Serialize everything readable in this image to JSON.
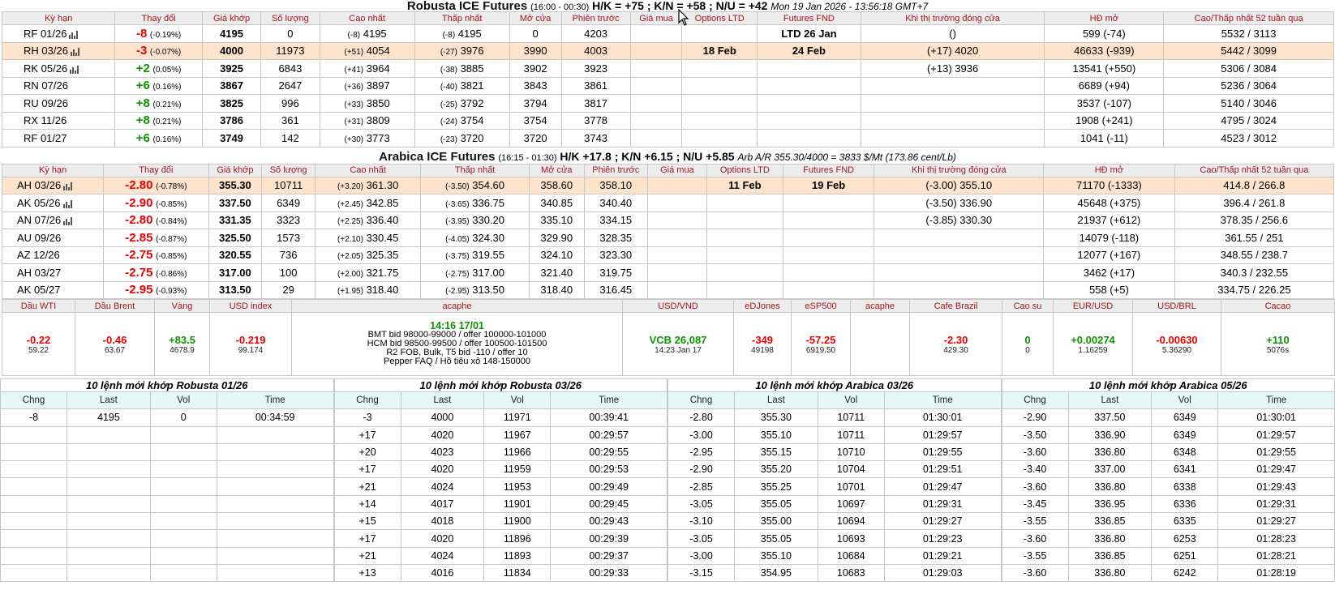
{
  "robusta": {
    "title": "Robusta ICE Futures",
    "hours": "(16:00 - 00:30)",
    "spreads": "H/K = +75 ; K/N = +58 ; N/U = +42",
    "stamp": "Mon 19 Jan 2026 - 13:56:18 GMT+7",
    "headers": [
      "Kỳ hạn",
      "Thay đổi",
      "Giá khớp",
      "Số lượng",
      "Cao nhất",
      "Thấp nhất",
      "Mở cửa",
      "Phiên trước",
      "Giá mua",
      "Options LTD",
      "Futures FND",
      "Khi thị trường đóng cửa",
      "HĐ mở",
      "Cao/Thấp nhất 52 tuần qua"
    ],
    "rows": [
      {
        "term": "RF 01/26",
        "icon": true,
        "chg": "-8",
        "pct": "(-0.19%)",
        "dir": "down",
        "last": "4195",
        "vol": "0",
        "hi_d": "(-8)",
        "hi": "4195",
        "lo_d": "(-8)",
        "lo": "4195",
        "open": "0",
        "prev": "4203",
        "bid": "",
        "opt": "",
        "fnd": "LTD 26 Jan",
        "close": "()",
        "oi": "599 (-74)",
        "range": "5532 / 3113",
        "hl": false
      },
      {
        "term": "RH 03/26",
        "icon": true,
        "chg": "-3",
        "pct": "(-0.07%)",
        "dir": "down",
        "last": "4000",
        "vol": "11973",
        "hi_d": "(+51)",
        "hi": "4054",
        "lo_d": "(-27)",
        "lo": "3976",
        "open": "3990",
        "prev": "4003",
        "bid": "",
        "opt": "18 Feb",
        "fnd": "24 Feb",
        "close": "(+17) 4020",
        "oi": "46633 (-939)",
        "range": "5442 / 3099",
        "hl": true
      },
      {
        "term": "RK 05/26",
        "icon": true,
        "chg": "+2",
        "pct": "(0.05%)",
        "dir": "up",
        "last": "3925",
        "vol": "6843",
        "hi_d": "(+41)",
        "hi": "3964",
        "lo_d": "(-38)",
        "lo": "3885",
        "open": "3902",
        "prev": "3923",
        "bid": "",
        "opt": "",
        "fnd": "",
        "close": "(+13) 3936",
        "oi": "13541 (+550)",
        "range": "5306 / 3084",
        "hl": false
      },
      {
        "term": "RN 07/26",
        "icon": false,
        "chg": "+6",
        "pct": "(0.16%)",
        "dir": "up",
        "last": "3867",
        "vol": "2647",
        "hi_d": "(+36)",
        "hi": "3897",
        "lo_d": "(-40)",
        "lo": "3821",
        "open": "3843",
        "prev": "3861",
        "bid": "",
        "opt": "",
        "fnd": "",
        "close": "",
        "oi": "6689 (+94)",
        "range": "5236 / 3064",
        "hl": false
      },
      {
        "term": "RU 09/26",
        "icon": false,
        "chg": "+8",
        "pct": "(0.21%)",
        "dir": "up",
        "last": "3825",
        "vol": "996",
        "hi_d": "(+33)",
        "hi": "3850",
        "lo_d": "(-25)",
        "lo": "3792",
        "open": "3794",
        "prev": "3817",
        "bid": "",
        "opt": "",
        "fnd": "",
        "close": "",
        "oi": "3537 (-107)",
        "range": "5140 / 3046",
        "hl": false
      },
      {
        "term": "RX 11/26",
        "icon": false,
        "chg": "+8",
        "pct": "(0.21%)",
        "dir": "up",
        "last": "3786",
        "vol": "361",
        "hi_d": "(+31)",
        "hi": "3809",
        "lo_d": "(-24)",
        "lo": "3754",
        "open": "3754",
        "prev": "3778",
        "bid": "",
        "opt": "",
        "fnd": "",
        "close": "",
        "oi": "1908 (+241)",
        "range": "4795 / 3024",
        "hl": false
      },
      {
        "term": "RF 01/27",
        "icon": false,
        "chg": "+6",
        "pct": "(0.16%)",
        "dir": "up",
        "last": "3749",
        "vol": "142",
        "hi_d": "(+30)",
        "hi": "3773",
        "lo_d": "(-23)",
        "lo": "3720",
        "open": "3720",
        "prev": "3743",
        "bid": "",
        "opt": "",
        "fnd": "",
        "close": "",
        "oi": "1041 (-11)",
        "range": "4523 / 3012",
        "hl": false
      }
    ]
  },
  "arabica": {
    "title": "Arabica ICE Futures",
    "hours": "(16:15 - 01:30)",
    "spreads": "H/K +17.8 ; K/N +6.15 ; N/U +5.85",
    "arb": "Arb A/R 355.30/4000 = 3833 $/Mt (173.86 cent/Lb)",
    "headers": [
      "Kỳ hạn",
      "Thay đổi",
      "Giá khớp",
      "Số lượng",
      "Cao nhất",
      "Thấp nhất",
      "Mở cửa",
      "Phiên trước",
      "Giá mua",
      "Options LTD",
      "Futures FND",
      "Khi thị trường đóng cửa",
      "HĐ mở",
      "Cao/Thấp nhất 52 tuần qua"
    ],
    "rows": [
      {
        "term": "AH 03/26",
        "icon": true,
        "chg": "-2.80",
        "pct": "(-0.78%)",
        "dir": "down",
        "last": "355.30",
        "vol": "10711",
        "hi_d": "(+3.20)",
        "hi": "361.30",
        "lo_d": "(-3.50)",
        "lo": "354.60",
        "open": "358.60",
        "prev": "358.10",
        "bid": "",
        "opt": "11 Feb",
        "fnd": "19 Feb",
        "close": "(-3.00) 355.10",
        "oi": "71170 (-1333)",
        "range": "414.8 / 266.8",
        "hl": true
      },
      {
        "term": "AK 05/26",
        "icon": true,
        "chg": "-2.90",
        "pct": "(-0.85%)",
        "dir": "down",
        "last": "337.50",
        "vol": "6349",
        "hi_d": "(+2.45)",
        "hi": "342.85",
        "lo_d": "(-3.65)",
        "lo": "336.75",
        "open": "340.85",
        "prev": "340.40",
        "bid": "",
        "opt": "",
        "fnd": "",
        "close": "(-3.50) 336.90",
        "oi": "45648 (+375)",
        "range": "396.4 / 261.8",
        "hl": false
      },
      {
        "term": "AN 07/26",
        "icon": true,
        "chg": "-2.80",
        "pct": "(-0.84%)",
        "dir": "down",
        "last": "331.35",
        "vol": "3323",
        "hi_d": "(+2.25)",
        "hi": "336.40",
        "lo_d": "(-3.95)",
        "lo": "330.20",
        "open": "335.10",
        "prev": "334.15",
        "bid": "",
        "opt": "",
        "fnd": "",
        "close": "(-3.85) 330.30",
        "oi": "21937 (+612)",
        "range": "378.35 / 256.6",
        "hl": false
      },
      {
        "term": "AU 09/26",
        "icon": false,
        "chg": "-2.85",
        "pct": "(-0.87%)",
        "dir": "down",
        "last": "325.50",
        "vol": "1573",
        "hi_d": "(+2.10)",
        "hi": "330.45",
        "lo_d": "(-4.05)",
        "lo": "324.30",
        "open": "329.90",
        "prev": "328.35",
        "bid": "",
        "opt": "",
        "fnd": "",
        "close": "",
        "oi": "14079 (-118)",
        "range": "361.55 / 251",
        "hl": false
      },
      {
        "term": "AZ 12/26",
        "icon": false,
        "chg": "-2.75",
        "pct": "(-0.85%)",
        "dir": "down",
        "last": "320.55",
        "vol": "736",
        "hi_d": "(+2.05)",
        "hi": "325.35",
        "lo_d": "(-3.75)",
        "lo": "319.55",
        "open": "324.10",
        "prev": "323.30",
        "bid": "",
        "opt": "",
        "fnd": "",
        "close": "",
        "oi": "12077 (+167)",
        "range": "348.55 / 238.7",
        "hl": false
      },
      {
        "term": "AH 03/27",
        "icon": false,
        "chg": "-2.75",
        "pct": "(-0.86%)",
        "dir": "down",
        "last": "317.00",
        "vol": "100",
        "hi_d": "(+2.00)",
        "hi": "321.75",
        "lo_d": "(-2.75)",
        "lo": "317.00",
        "open": "321.40",
        "prev": "319.75",
        "bid": "",
        "opt": "",
        "fnd": "",
        "close": "",
        "oi": "3462 (+17)",
        "range": "340.3 / 232.55",
        "hl": false
      },
      {
        "term": "AK 05/27",
        "icon": false,
        "chg": "-2.95",
        "pct": "(-0.93%)",
        "dir": "down",
        "last": "313.50",
        "vol": "29",
        "hi_d": "(+1.95)",
        "hi": "318.40",
        "lo_d": "(-2.95)",
        "lo": "313.50",
        "open": "318.40",
        "prev": "316.45",
        "bid": "",
        "opt": "",
        "fnd": "",
        "close": "",
        "oi": "558 (+5)",
        "range": "334.75 / 226.25",
        "hl": false
      }
    ]
  },
  "markets": {
    "headers": [
      "Dầu WTI",
      "Dầu Brent",
      "Vàng",
      "USD index",
      "acaphe",
      "USD/VND",
      "eDJones",
      "eSP500",
      "acaphe",
      "Cafe Brazil",
      "Cao su",
      "EUR/USD",
      "USD/BRL",
      "Cacao"
    ],
    "wti": {
      "chg": "-0.22",
      "val": "59.22"
    },
    "brent": {
      "chg": "-0.46",
      "val": "63.67"
    },
    "gold": {
      "chg": "+83.5",
      "val": "4678.9"
    },
    "usdindex": {
      "chg": "-0.219",
      "val": "99.174"
    },
    "acaphe_note": {
      "time": "14:16 17/01",
      "lines": [
        "BMT bid 98000-99000 / offer 100000-101000",
        "HCM bid 98500-99500 / offer 100500-101500",
        "R2 FOB, Bulk, T5 bid -110 / offer 10",
        "Pepper FAQ / Hồ tiêu xô 148-150000"
      ]
    },
    "usdvnd": {
      "chg": "VCB 26,087",
      "val": "14:23 Jan 17"
    },
    "edjones": {
      "chg": "-349",
      "val": "49198"
    },
    "esp500": {
      "chg": "-57.25",
      "val": "6919.50"
    },
    "acaphe2": {
      "chg": "",
      "val": ""
    },
    "brazil": {
      "chg": "-2.30",
      "val": "429.30"
    },
    "rubber": {
      "chg": "0",
      "val": "0"
    },
    "eurusd": {
      "chg": "+0.00274",
      "val": "1.16259"
    },
    "usdbrl": {
      "chg": "-0.00630",
      "val": "5.36290"
    },
    "cacao": {
      "chg": "+110",
      "val": "5076s"
    }
  },
  "trades": {
    "col_headers": [
      "Chng",
      "Last",
      "Vol",
      "Time"
    ],
    "panels": [
      {
        "title": "10 lệnh mới khớp Robusta 01/26",
        "rows": [
          [
            "-8",
            "4195",
            "0",
            "00:34:59"
          ],
          [
            "",
            "",
            "",
            ""
          ],
          [
            "",
            "",
            "",
            ""
          ],
          [
            "",
            "",
            "",
            ""
          ],
          [
            "",
            "",
            "",
            ""
          ],
          [
            "",
            "",
            "",
            ""
          ],
          [
            "",
            "",
            "",
            ""
          ],
          [
            "",
            "",
            "",
            ""
          ],
          [
            "",
            "",
            "",
            ""
          ],
          [
            "",
            "",
            "",
            ""
          ]
        ]
      },
      {
        "title": "10 lệnh mới khớp Robusta 03/26",
        "rows": [
          [
            "-3",
            "4000",
            "11971",
            "00:39:41"
          ],
          [
            "+17",
            "4020",
            "11967",
            "00:29:57"
          ],
          [
            "+20",
            "4023",
            "11966",
            "00:29:55"
          ],
          [
            "+17",
            "4020",
            "11959",
            "00:29:53"
          ],
          [
            "+21",
            "4024",
            "11953",
            "00:29:49"
          ],
          [
            "+14",
            "4017",
            "11901",
            "00:29:45"
          ],
          [
            "+15",
            "4018",
            "11900",
            "00:29:43"
          ],
          [
            "+17",
            "4020",
            "11896",
            "00:29:39"
          ],
          [
            "+21",
            "4024",
            "11893",
            "00:29:37"
          ],
          [
            "+13",
            "4016",
            "11834",
            "00:29:33"
          ]
        ]
      },
      {
        "title": "10 lệnh mới khớp Arabica 03/26",
        "rows": [
          [
            "-2.80",
            "355.30",
            "10711",
            "01:30:01"
          ],
          [
            "-3.00",
            "355.10",
            "10711",
            "01:29:57"
          ],
          [
            "-2.95",
            "355.15",
            "10710",
            "01:29:55"
          ],
          [
            "-2.90",
            "355.20",
            "10704",
            "01:29:51"
          ],
          [
            "-2.85",
            "355.25",
            "10701",
            "01:29:47"
          ],
          [
            "-3.05",
            "355.05",
            "10697",
            "01:29:31"
          ],
          [
            "-3.10",
            "355.00",
            "10694",
            "01:29:27"
          ],
          [
            "-3.05",
            "355.05",
            "10693",
            "01:29:23"
          ],
          [
            "-3.00",
            "355.10",
            "10684",
            "01:29:21"
          ],
          [
            "-3.15",
            "354.95",
            "10683",
            "01:29:03"
          ]
        ]
      },
      {
        "title": "10 lệnh mới khớp Arabica 05/26",
        "rows": [
          [
            "-2.90",
            "337.50",
            "6349",
            "01:30:01"
          ],
          [
            "-3.50",
            "336.90",
            "6349",
            "01:29:57"
          ],
          [
            "-3.60",
            "336.80",
            "6348",
            "01:29:55"
          ],
          [
            "-3.40",
            "337.00",
            "6341",
            "01:29:47"
          ],
          [
            "-3.60",
            "336.80",
            "6338",
            "01:29:43"
          ],
          [
            "-3.45",
            "336.95",
            "6336",
            "01:29:31"
          ],
          [
            "-3.55",
            "336.85",
            "6335",
            "01:29:27"
          ],
          [
            "-3.60",
            "336.80",
            "6253",
            "01:28:23"
          ],
          [
            "-3.55",
            "336.85",
            "6251",
            "01:28:21"
          ],
          [
            "-3.60",
            "336.80",
            "6242",
            "01:28:19"
          ]
        ]
      }
    ]
  },
  "colors": {
    "down": "#ec0000",
    "up": "#0a9400",
    "header_text": "#a0161e",
    "highlight": "#fde3cc"
  }
}
